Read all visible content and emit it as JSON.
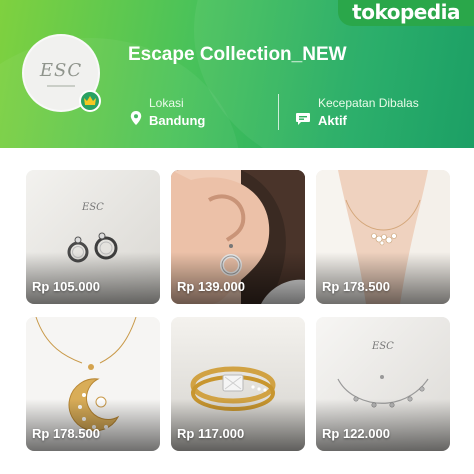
{
  "brand": {
    "name": "tokopedia"
  },
  "shop": {
    "name": "Escape Collection_NEW",
    "logo_text": "ESC",
    "badge_icon": "crown-icon",
    "location_label": "Lokasi",
    "location_value": "Bandung",
    "response_label": "Kecepatan Dibalas",
    "response_value": "Aktif"
  },
  "products": [
    {
      "price": "Rp 105.000",
      "image": "circle-stud-earrings"
    },
    {
      "price": "Rp 139.000",
      "image": "ring-drop-earring-on-ear"
    },
    {
      "price": "Rp 178.500",
      "image": "crystal-necklace-on-neck"
    },
    {
      "price": "Rp 178.500",
      "image": "crescent-moon-necklace"
    },
    {
      "price": "Rp 117.000",
      "image": "gold-crystal-ring"
    },
    {
      "price": "Rp 122.000",
      "image": "silver-charm-bracelet"
    }
  ],
  "colors": {
    "brand_green": "#2aa74a",
    "header_start": "#7fd13f",
    "header_end": "#0e9a5c"
  }
}
